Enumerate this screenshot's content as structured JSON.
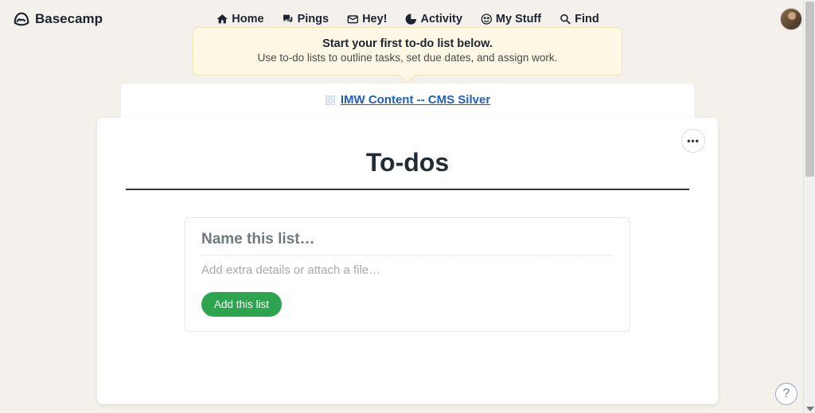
{
  "brand": "Basecamp",
  "nav": {
    "home": "Home",
    "pings": "Pings",
    "hey": "Hey!",
    "activity": "Activity",
    "mystuff": "My Stuff",
    "find": "Find"
  },
  "tip": {
    "title": "Start your first to-do list below.",
    "sub": "Use to-do lists to outline tasks, set due dates, and assign work."
  },
  "project": {
    "name": "IMW Content -- CMS Silver"
  },
  "page": {
    "title": "To-dos"
  },
  "form": {
    "name_placeholder": "Name this list…",
    "details_placeholder": "Add extra details or attach a file…",
    "add_label": "Add this list"
  },
  "help_label": "?"
}
